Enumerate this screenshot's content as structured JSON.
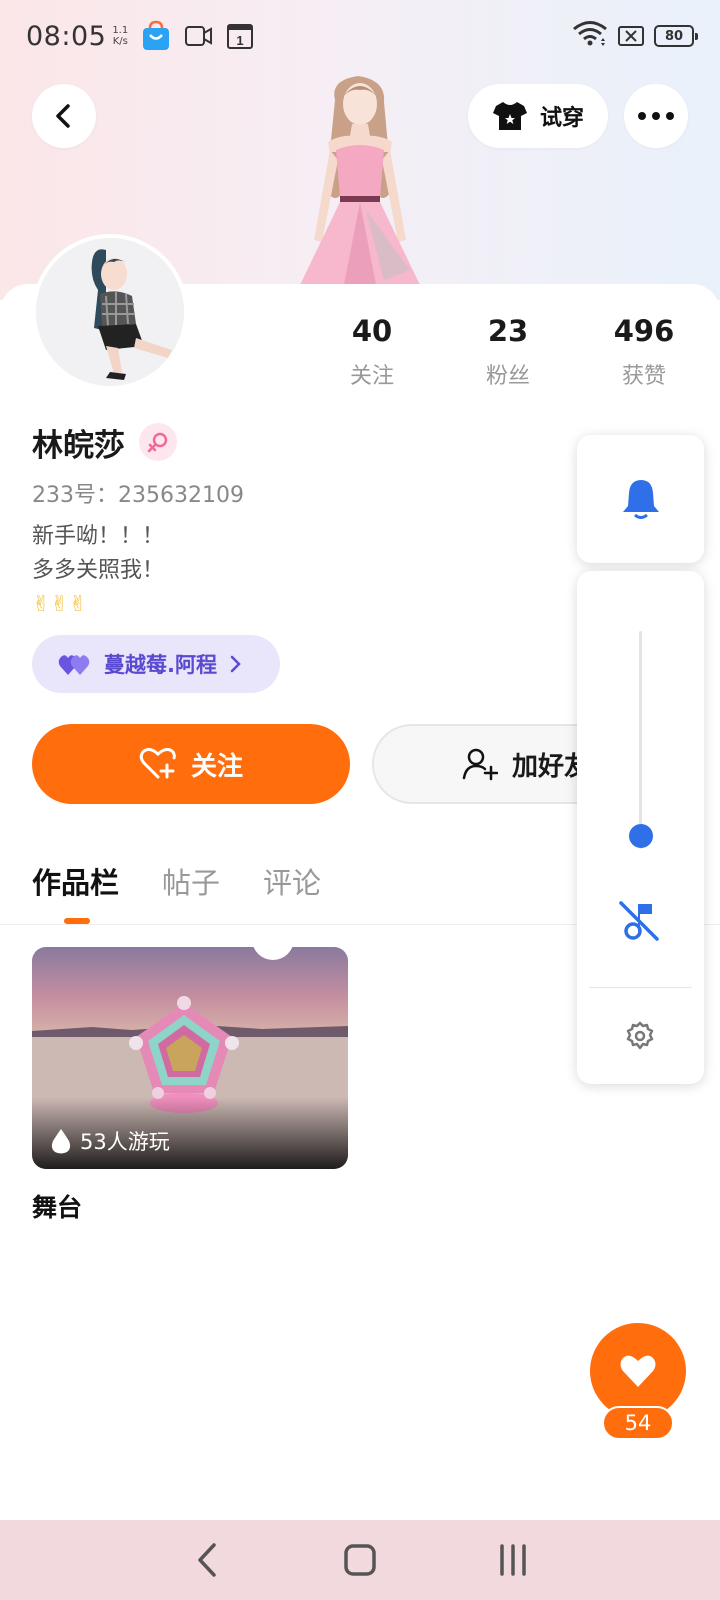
{
  "status_bar": {
    "time": "08:05",
    "net_speed_value": "1.1",
    "net_speed_unit": "K/s",
    "calendar_day": "1",
    "battery": "80"
  },
  "header": {
    "try_on_label": "试穿"
  },
  "profile": {
    "stats": [
      {
        "value": "40",
        "label": "关注"
      },
      {
        "value": "23",
        "label": "粉丝"
      },
      {
        "value": "496",
        "label": "获赞"
      }
    ],
    "name": "林皖莎",
    "id_text": "233号：235632109",
    "bio_lines": [
      "新手呦！！！",
      "多多关照我！",
      "✌✌✌"
    ],
    "partner_name": "蔓越莓.阿程"
  },
  "actions": {
    "follow_label": "关注",
    "add_friend_label": "加好友"
  },
  "tabs": [
    {
      "label": "作品栏"
    },
    {
      "label": "帖子"
    },
    {
      "label": "评论"
    }
  ],
  "works": [
    {
      "title": "舞台",
      "players": "53人游玩"
    }
  ],
  "like": {
    "count": "54"
  },
  "volume": {
    "level": 0.06
  },
  "colors": {
    "accent": "#ff6d0d",
    "panel_blue": "#2f6fe8",
    "partner_purple": "#5a4ad1"
  },
  "icons": [
    "back-icon",
    "tshirt-icon",
    "more-icon",
    "female-icon",
    "heart-icon",
    "add-user-icon",
    "bell-icon",
    "music-off-icon",
    "gear-icon",
    "flame-icon"
  ]
}
